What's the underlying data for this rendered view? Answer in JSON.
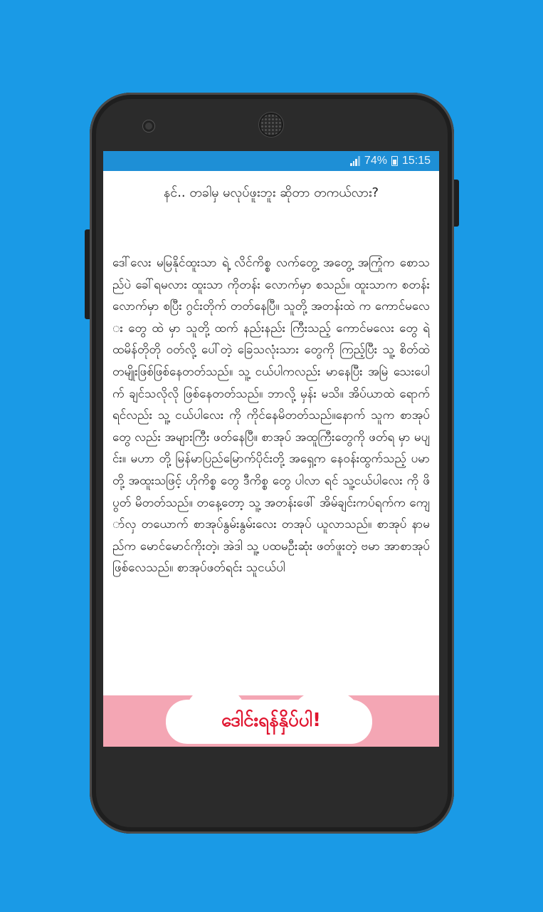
{
  "status_bar": {
    "battery_percent": "74%",
    "time": "15:15"
  },
  "article": {
    "title": "နင်.. တခါမှ မလုပ်ဖူးဘူး ဆိုတာ တကယ်လား?",
    "body": "ဒေါ်လေး မမြနိုင်ထူးသာ ရဲ့ လိင်ကိစ္စ လက်တွေ့ အတွေ့ အကြုံက စောသည်ပဲ ခေါ်ရမလား ထူးသာ ကိုတန်း လောက်မှာ စသည်။ ထူးသာက စတန်း လောက်မှာ စပြီး ဂွင်းတိုက် တတ်နေပြီ။ သူတို့ အတန်းထဲ က ကောင်မလေး တွေ ထဲ မှာ သူတို့ ထက် နည်းနည်း ကြီးသည့် ကောင်မလေး တွေ ရဲ့ ထမိန်တိုတို ဝတ်လို့ ပေါ်တဲ့ ခြေသလုံးသား တွေကို ကြည့်ပြီး သူ့ စိတ်ထဲ တမျိုးဖြစ်ဖြစ်နေတတ်သည်။ သူ့ ငယ်ပါကလည်း မာနေပြီး အမြဲ သေးပေါက် ချင်သလိုလို ဖြစ်နေတတ်သည်။ ဘာလို့ မှန်း မသိ။ အိပ်ယာထဲ ရောက်ရင်လည်း သူ့ ငယ်ပါလေး ကို ကိုင်နေမိတတ်သည်။နောက် သူက စာအုပ်တွေ လည်း အများကြီး ဖတ်နေပြီ။ စာအုပ် အထူကြီးတွေကို ဖတ်ရ မှာ မပျင်း။ မဟာ တို့ မြန်မာပြည်မြောက်ပိုင်းတို့ အရှေ့က နေဝန်းထွက်သည့် ပမာတို့ အထူးသဖြင့် ဟိုကိစ္စ တွေ ဒီကိစ္စ တွေ ပါလာ ရင် သူ့ငယ်ပါလေး ကို ဖိပွတ် မိတတ်သည်။ တနေ့တော့ သူ့ အတန်းဖေါ် အိမ်ချင်းကပ်ရက်က ကျော်လှ တယောက် စာအုပ်နွမ်းနွမ်းလေး တအုပ် ယူလာသည်။ စာအုပ် နာမည်က မောင်မောင်ကိုးတဲ့၊ အဲဒါ သူ့ ပထမဦးဆုံး ဖတ်ဖူးတဲ့ ဗမာ အာစာအုပ် ဖြစ်လေသည်။ စာအုပ်ဖတ်ရင်း သူငယ်ပါ"
  },
  "ad": {
    "text": "ဒေါင်းရန်နှိပ်ပါ!"
  },
  "colors": {
    "background": "#1a9ae6",
    "status_bar": "#1e8fd6",
    "ad_background": "#f4a6b4",
    "ad_text": "#e0152f"
  },
  "icons": [
    "signal-icon",
    "battery-charging-icon",
    "front-camera-icon",
    "earpiece-speaker-icon"
  ]
}
